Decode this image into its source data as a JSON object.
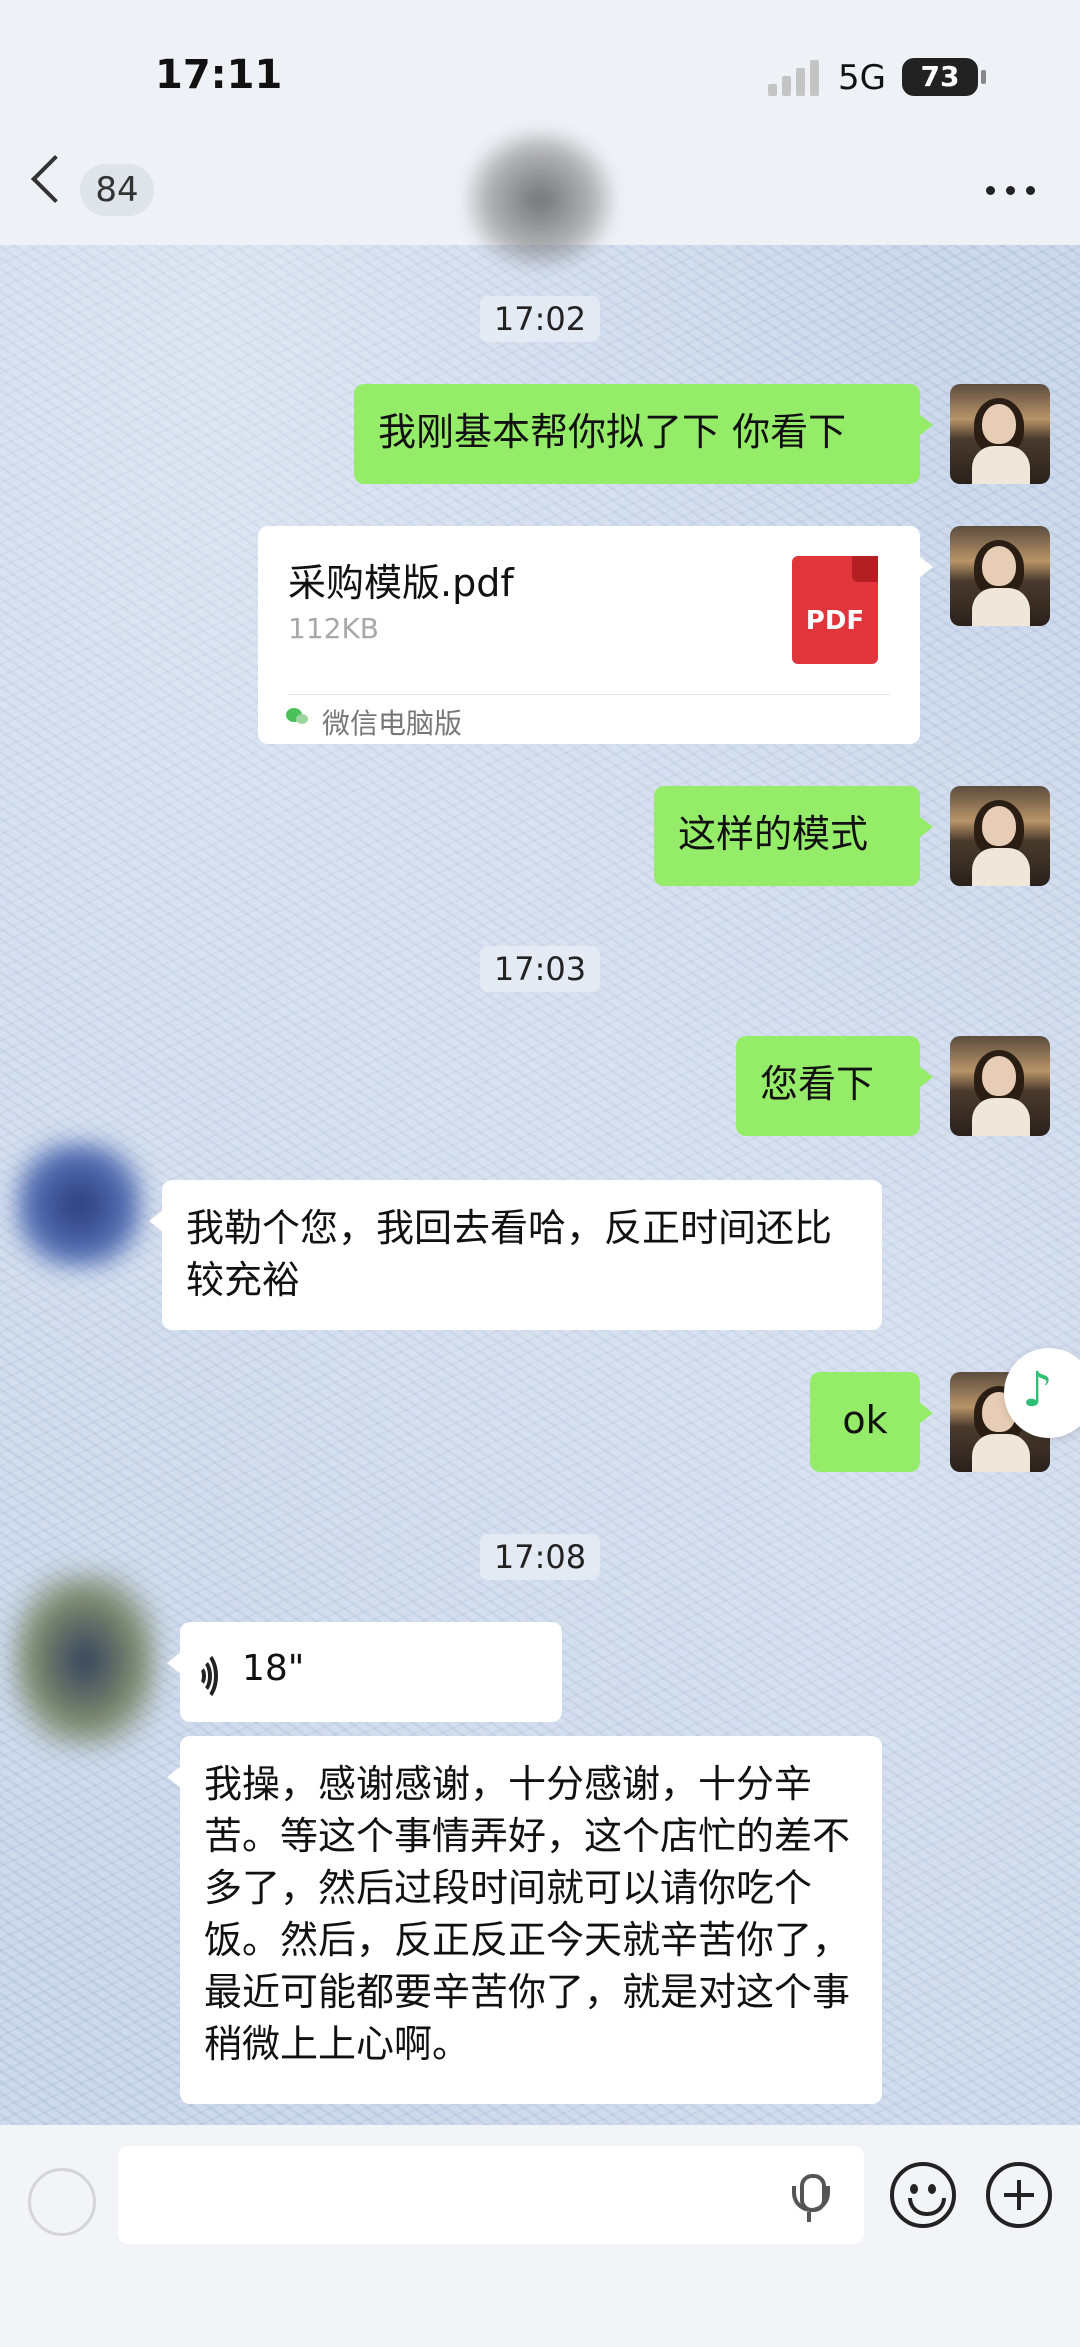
{
  "status_bar": {
    "time": "17:11",
    "network": "5G",
    "battery": "73"
  },
  "header": {
    "back_count": "84"
  },
  "messages": {
    "ts1": "17:02",
    "m1": "我刚基本帮你拟了下 你看下",
    "file": {
      "name": "采购模版.pdf",
      "size": "112KB",
      "badge": "PDF",
      "source": "微信电脑版"
    },
    "m2": "这样的模式",
    "ts2": "17:03",
    "m3": "您看下",
    "m4": "我勒个您，我回去看哈，反正时间还比较充裕",
    "m5": "ok",
    "ts3": "17:08",
    "voice_duration": "18\"",
    "m6": "我操，感谢感谢，十分感谢，十分辛苦。等这个事情弄好，这个店忙的差不多了，然后过段时间就可以请你吃个饭。然后，反正反正今天就辛苦你了，最近可能都要辛苦你了，就是对这个事稍微上上心啊。"
  },
  "colors": {
    "my_bubble": "#95ec69",
    "other_bubble": "#ffffff",
    "pdf_red": "#e0353a"
  },
  "icons": [
    "back-chevron-icon",
    "more-icon",
    "pdf-icon",
    "wechat-icon",
    "voice-wave-icon",
    "music-note-icon",
    "microphone-icon",
    "emoji-icon",
    "plus-icon"
  ]
}
